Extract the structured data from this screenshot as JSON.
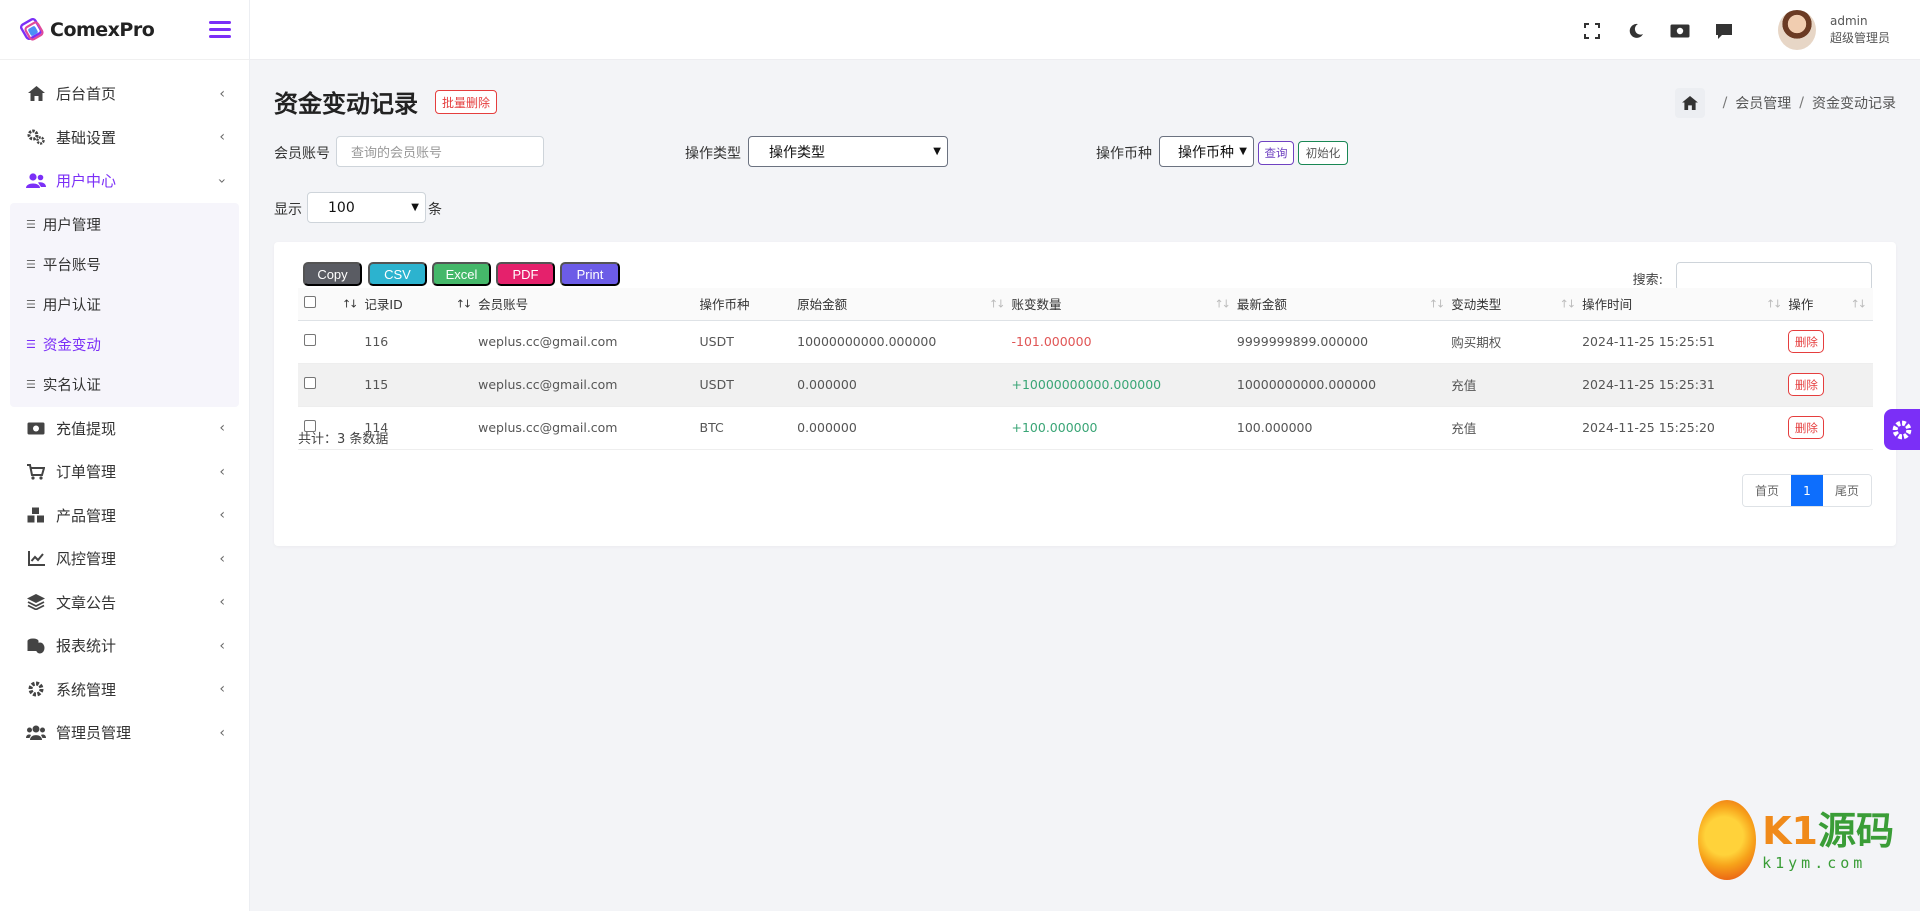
{
  "brand": {
    "name": "ComexPro"
  },
  "sidebar": {
    "items": [
      {
        "label": "后台首页"
      },
      {
        "label": "基础设置"
      },
      {
        "label": "用户中心"
      },
      {
        "label": "充值提现"
      },
      {
        "label": "订单管理"
      },
      {
        "label": "产品管理"
      },
      {
        "label": "风控管理"
      },
      {
        "label": "文章公告"
      },
      {
        "label": "报表统计"
      },
      {
        "label": "系统管理"
      },
      {
        "label": "管理员管理"
      }
    ],
    "submenu": [
      {
        "label": "用户管理"
      },
      {
        "label": "平台账号"
      },
      {
        "label": "用户认证"
      },
      {
        "label": "资金变动"
      },
      {
        "label": "实名认证"
      }
    ]
  },
  "header": {
    "user_name": "admin",
    "user_role": "超级管理员"
  },
  "page": {
    "title": "资金变动记录",
    "batch_delete": "批量删除",
    "breadcrumb": [
      "会员管理",
      "资金变动记录"
    ]
  },
  "filters": {
    "member_label": "会员账号",
    "member_placeholder": "查询的会员账号",
    "op_type_label": "操作类型",
    "op_type_value": "操作类型",
    "currency_label": "操作币种",
    "currency_value": "操作币种",
    "query_btn": "查询",
    "reset_btn": "初始化",
    "show_label": "显示",
    "show_value": "100",
    "show_suffix": "条"
  },
  "toolbar": {
    "copy": "Copy",
    "csv": "CSV",
    "excel": "Excel",
    "pdf": "PDF",
    "print": "Print",
    "search_label": "搜索:"
  },
  "table": {
    "headers": [
      "记录ID",
      "会员账号",
      "操作币种",
      "原始金额",
      "账变数量",
      "最新金额",
      "变动类型",
      "操作时间",
      "操作"
    ],
    "rows": [
      {
        "id": "116",
        "account": "weplus.cc@gmail.com",
        "currency": "USDT",
        "orig": "10000000000.000000",
        "change": "-101.000000",
        "latest": "9999999899.000000",
        "type": "购买期权",
        "time": "2024-11-25 15:25:51",
        "action": "删除"
      },
      {
        "id": "115",
        "account": "weplus.cc@gmail.com",
        "currency": "USDT",
        "orig": "0.000000",
        "change": "+10000000000.000000",
        "latest": "10000000000.000000",
        "type": "充值",
        "time": "2024-11-25 15:25:31",
        "action": "删除"
      },
      {
        "id": "114",
        "account": "weplus.cc@gmail.com",
        "currency": "BTC",
        "orig": "0.000000",
        "change": "+100.000000",
        "latest": "100.000000",
        "type": "充值",
        "time": "2024-11-25 15:25:20",
        "action": "删除"
      }
    ]
  },
  "footer": {
    "total": "共计：3 条数据",
    "first": "首页",
    "current": "1",
    "last": "尾页"
  },
  "watermark": {
    "main_k1": "K1",
    "main_ym": "源码",
    "sub": "k1ym.com"
  },
  "colors": {
    "accent": "#7b2ff7",
    "danger": "#e53e3e",
    "positive": "#3aa576"
  }
}
